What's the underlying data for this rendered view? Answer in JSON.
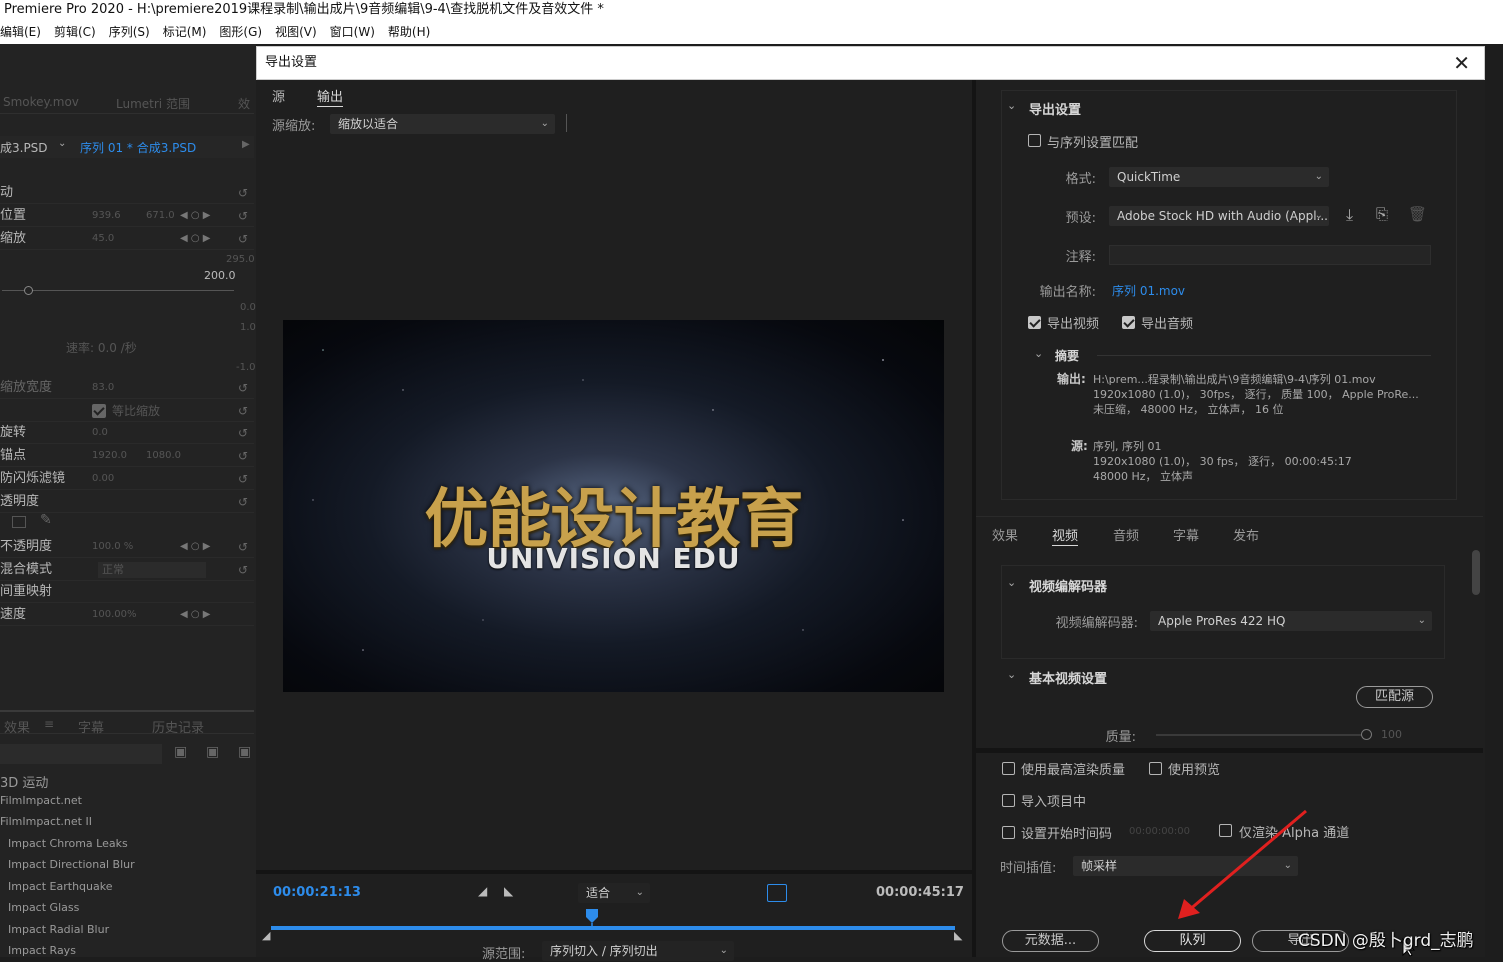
{
  "window": {
    "title": "Premiere Pro 2020 - H:\\premiere2019课程录制\\输出成片\\9音频编辑\\9-4\\查找脱机文件及音效文件 *"
  },
  "menu": [
    "编辑(E)",
    "剪辑(C)",
    "序列(S)",
    "标记(M)",
    "图形(G)",
    "视图(V)",
    "窗口(W)",
    "帮助(H)"
  ],
  "left_panel": {
    "tabs": [
      "Smokey.mov",
      "Lumetri 范围",
      "效"
    ],
    "clip_name": "成3.PSD",
    "sequence_name": "序列 01 * 合成3.PSD",
    "params": [
      {
        "label": "动",
        "v1": "",
        "v2": ""
      },
      {
        "label": "位置",
        "v1": "939.6",
        "v2": "671.0"
      },
      {
        "label": "缩放",
        "v1": "45.0",
        "v2": ""
      }
    ],
    "scale_max": "295.0",
    "scale_value": "200.0",
    "side_values": [
      "0.0",
      "1.0",
      "-1.0"
    ],
    "rate_label": "速率: 0.0 /秒",
    "params2": [
      {
        "label": "缩放宽度",
        "v1": "83.0",
        "v2": ""
      },
      {
        "label": "",
        "v1": "等比缩放",
        "v2": ""
      },
      {
        "label": "旋转",
        "v1": "0.0",
        "v2": ""
      },
      {
        "label": "锚点",
        "v1": "1920.0",
        "v2": "1080.0"
      },
      {
        "label": "防闪烁滤镜",
        "v1": "0.00",
        "v2": ""
      },
      {
        "label": "透明度",
        "v1": "",
        "v2": ""
      }
    ],
    "params3": [
      {
        "label": "不透明度",
        "v1": "100.0 %",
        "v2": ""
      },
      {
        "label": "混合模式",
        "v1": "正常",
        "v2": ""
      },
      {
        "label": "间重映射",
        "v1": "",
        "v2": ""
      },
      {
        "label": "速度",
        "v1": "100.00%",
        "v2": ""
      }
    ],
    "bottom_tabs": [
      "效果",
      "字幕",
      "历史记录"
    ],
    "effects_list": [
      "3D 运动",
      "FilmImpact.net",
      "FilmImpact.net II",
      "Impact Chroma Leaks",
      "Impact Directional Blur",
      "Impact Earthquake",
      "Impact Glass",
      "Impact Radial Blur",
      "Impact Rays"
    ]
  },
  "dialog": {
    "title": "导出设置",
    "close": "✕",
    "tabs": [
      "源",
      "输出"
    ],
    "source_scaling_label": "源缩放:",
    "source_scaling_value": "缩放以适合",
    "preview": {
      "logo_cn": "优能设计教育",
      "logo_en": "UNIVISION EDU"
    },
    "timeline": {
      "current_time": "00:00:21:13",
      "fit_value": "适合",
      "end_time": "00:00:45:17",
      "range_label": "源范围:",
      "range_value": "序列切入 / 序列切出",
      "playhead_fraction": 0.47
    },
    "export_settings": {
      "section_title": "导出设置",
      "match_sequence": "与序列设置匹配",
      "format_label": "格式:",
      "format_value": "QuickTime",
      "preset_label": "预设:",
      "preset_value": "Adobe Stock HD with Audio (Appl...",
      "comments_label": "注释:",
      "output_name_label": "输出名称:",
      "output_name_value": "序列 01.mov",
      "export_video": "导出视频",
      "export_audio": "导出音频",
      "summary_title": "摘要",
      "output_label": "输出:",
      "output_lines": [
        "H:\\prem...程录制\\输出成片\\9音频编辑\\9-4\\序列 01.mov",
        "1920x1080 (1.0)， 30fps， 逐行， 质量 100， Apple ProRe...",
        "未压缩， 48000 Hz， 立体声， 16 位"
      ],
      "source_label": "源:",
      "source_lines": [
        "序列, 序列 01",
        "1920x1080 (1.0)， 30 fps， 逐行， 00:00:45:17",
        "48000 Hz， 立体声"
      ]
    },
    "right_tabs": [
      "效果",
      "视频",
      "音频",
      "字幕",
      "发布"
    ],
    "video_codec": {
      "section_title": "视频编解码器",
      "codec_label": "视频编解码器:",
      "codec_value": "Apple ProRes 422 HQ"
    },
    "basic_video": {
      "section_title": "基本视频设置",
      "match_source": "匹配源",
      "quality_label": "质量:",
      "quality_value": "100"
    },
    "bottom_options": {
      "max_render": "使用最高渲染质量",
      "use_previews": "使用预览",
      "import_project": "导入项目中",
      "set_start_tc": "设置开始时间码",
      "start_tc_value": "00:00:00:00",
      "alpha_only": "仅渲染 Alpha 通道",
      "time_interp_label": "时间插值:",
      "time_interp_value": "帧采样"
    },
    "buttons": {
      "metadata": "元数据...",
      "queue": "队列",
      "export": "导出"
    }
  },
  "watermark": "CSDN @殷卜grd_志鹏",
  "colors": {
    "accent_blue": "#2d8ceb",
    "arrow_red": "#e0201f",
    "logo_gold": "#c8a14c"
  }
}
